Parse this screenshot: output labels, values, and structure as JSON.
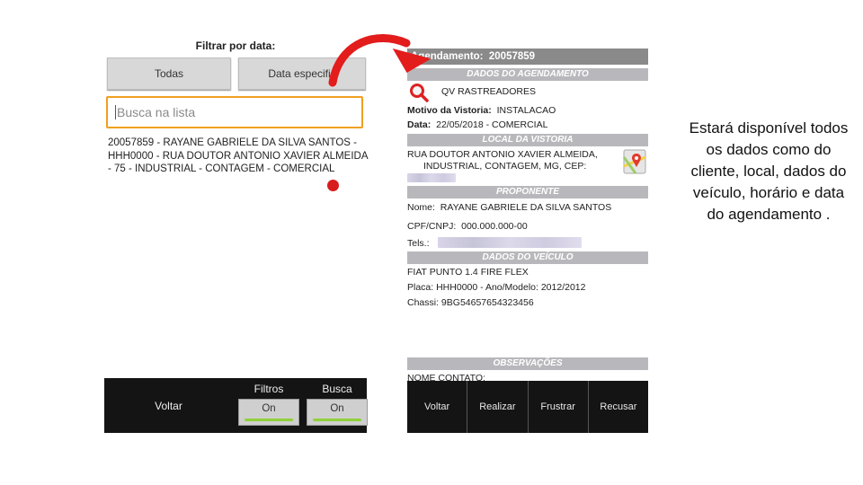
{
  "left_screen": {
    "filter_title": "Filtrar por data:",
    "btn_todas": "Todas",
    "btn_data": "Data especific",
    "search_placeholder": "Busca na lista",
    "list_item": "20057859 - RAYANE GABRIELE DA SILVA SANTOS - HHH0000 - RUA DOUTOR ANTONIO XAVIER ALMEIDA - 75 - INDUSTRIAL - CONTAGEM - COMERCIAL",
    "bottom": {
      "voltar": "Voltar",
      "filtros_label": "Filtros",
      "filtros_value": "On",
      "busca_label": "Busca",
      "busca_value": "On"
    }
  },
  "right_screen": {
    "header_label": "Agendamento:",
    "header_id": "20057859",
    "sec_agendamento": "DADOS DO AGENDAMENTO",
    "company": "QV RASTREADORES",
    "motivo_label": "Motivo da Vistoria:",
    "motivo_value": "INSTALACAO",
    "data_label": "Data:",
    "data_value": "22/05/2018  -  COMERCIAL",
    "sec_local": "LOCAL DA VISTORIA",
    "address_line1": "RUA DOUTOR ANTONIO XAVIER ALMEIDA,",
    "address_line2": "INDUSTRIAL, CONTAGEM, MG, CEP:",
    "sec_proponente": "PROPONENTE",
    "nome_label": "Nome:",
    "nome_value": "RAYANE GABRIELE DA SILVA SANTOS",
    "cpf_label": "CPF/CNPJ:",
    "cpf_value": "000.000.000-00",
    "tels_label": "Tels.:",
    "sec_veiculo": "DADOS DO VEÍCULO",
    "vehicle_model": "FIAT  PUNTO 1.4 FIRE FLEX",
    "placa_line": "Placa:  HHH0000   -   Ano/Modelo:  2012/2012",
    "chassi_line": "Chassi:  9BG54657654323456",
    "sec_obs": "OBSERVAÇÕES",
    "nome_contato": "NOME CONTATO:",
    "buttons": {
      "voltar": "Voltar",
      "realizar": "Realizar",
      "frustrar": "Frustrar",
      "recusar": "Recusar"
    }
  },
  "caption": "Estará disponível todos os dados como do cliente, local, dados do veículo, horário e data do agendamento .",
  "colors": {
    "search_border": "#f0a020",
    "section_bar": "#b8b8bc",
    "header_bar": "#8a8a8a",
    "arrow": "#e31c1c",
    "toggle_on": "#8fd13a",
    "bottom_bar": "#141414"
  },
  "icons": [
    "magnifier-icon",
    "map-pin-icon",
    "curved-arrow-icon",
    "red-dot-marker"
  ]
}
